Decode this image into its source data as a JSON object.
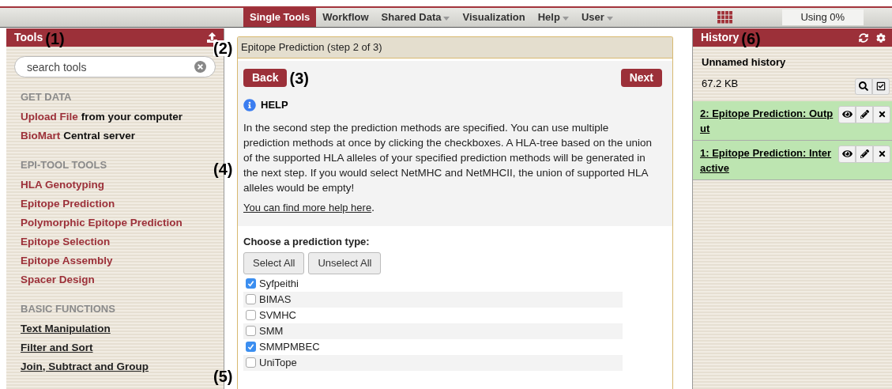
{
  "masthead": {
    "tabs": [
      {
        "label": "Single Tools",
        "selected": true,
        "dropdown": false
      },
      {
        "label": "Workflow",
        "selected": false,
        "dropdown": false
      },
      {
        "label": "Shared Data",
        "selected": false,
        "dropdown": true
      },
      {
        "label": "Visualization",
        "selected": false,
        "dropdown": false
      },
      {
        "label": "Help",
        "selected": false,
        "dropdown": true
      },
      {
        "label": "User",
        "selected": false,
        "dropdown": true
      }
    ],
    "usage": "Using 0%"
  },
  "tools_panel": {
    "title": "Tools",
    "callout": "(1)",
    "search": {
      "placeholder": "search tools"
    },
    "sections": [
      {
        "heading": "GET DATA",
        "items": [
          {
            "kind": "tool",
            "link": "Upload File",
            "rest": "from your computer"
          },
          {
            "kind": "tool",
            "link": "BioMart",
            "rest": "Central server"
          }
        ]
      },
      {
        "heading": "EPI-TOOL TOOLS",
        "items": [
          {
            "kind": "tool",
            "link": "HLA Genotyping"
          },
          {
            "kind": "tool",
            "link": "Epitope Prediction"
          },
          {
            "kind": "tool",
            "link": "Polymorphic Epitope Prediction"
          },
          {
            "kind": "tool",
            "link": "Epitope Selection"
          },
          {
            "kind": "tool",
            "link": "Epitope Assembly"
          },
          {
            "kind": "tool",
            "link": "Spacer Design"
          }
        ]
      },
      {
        "heading": "BASIC FUNCTIONS",
        "items": [
          {
            "kind": "basic",
            "link": "Text Manipulation"
          },
          {
            "kind": "basic",
            "link": "Filter and Sort"
          },
          {
            "kind": "basic",
            "link": "Join, Subtract and Group"
          }
        ]
      }
    ]
  },
  "center": {
    "header": "Epitope Prediction (step 2 of 3)",
    "header_callout": "(2)",
    "back": "Back",
    "back_callout": "(3)",
    "next": "Next",
    "help": {
      "title": "HELP",
      "callout": "(4)",
      "text": "In the second step the prediction methods are specified. You can use multiple prediction methods at once by clicking the checkboxes. A HLA-tree based on the union of the supported HLA alleles of your specified prediction methods will be generated in the next step. If you would select NetMHC and NetMHCII, the union of supported HLA alleles would be empty!",
      "link": "You can find more help here",
      "link_tail": "."
    },
    "form": {
      "label": "Choose a prediction type:",
      "select_all": "Select All",
      "unselect_all": "Unselect All",
      "callout": "(5)",
      "options": [
        {
          "label": "Syfpeithi",
          "checked": true
        },
        {
          "label": "BIMAS",
          "checked": false
        },
        {
          "label": "SVMHC",
          "checked": false
        },
        {
          "label": "SMM",
          "checked": false
        },
        {
          "label": "SMMPMBEC",
          "checked": true
        },
        {
          "label": "UniTope",
          "checked": false
        }
      ]
    }
  },
  "history_panel": {
    "title": "History",
    "callout": "(6)",
    "name": "Unnamed history",
    "size": "67.2 KB",
    "datasets": [
      {
        "title": "2: Epitope Prediction: Output"
      },
      {
        "title": "1: Epitope Prediction: Interactive"
      }
    ]
  }
}
